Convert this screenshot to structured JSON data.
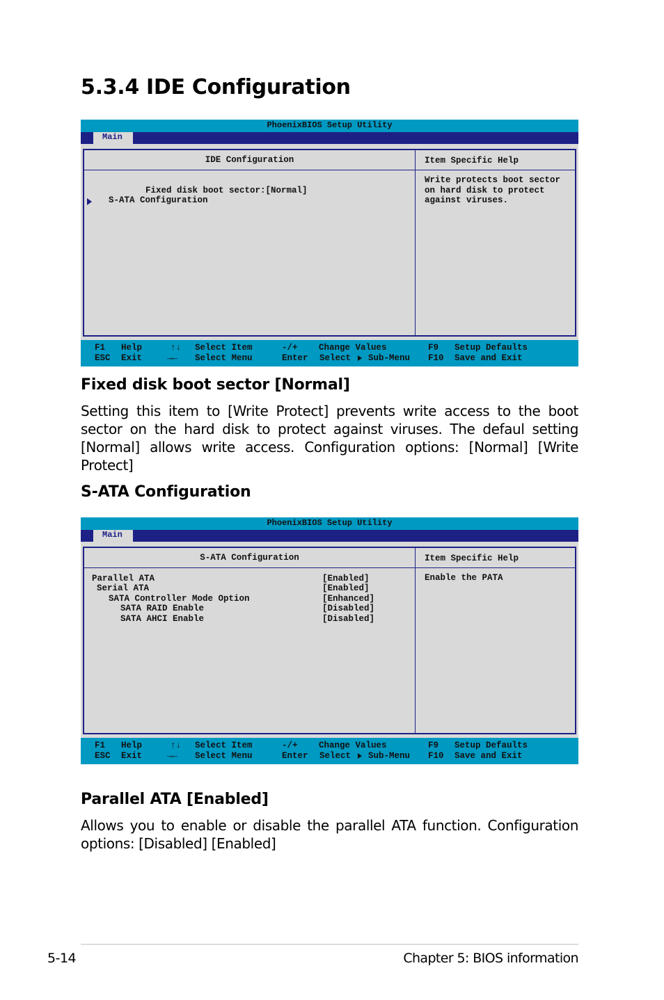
{
  "page_title": "5.3.4 IDE Configuration",
  "screens": [
    {
      "utility_title": "PhoenixBIOS Setup Utility",
      "menu_tab": "Main",
      "panel_title": "IDE Configuration",
      "help_title": "Item Specific Help",
      "help_text": "Write protects boot sector\non hard disk to protect\nagainst viruses.",
      "items": [
        {
          "label": "Fixed disk boot sector:",
          "value": "[Normal]"
        },
        {
          "label": "S-ATA Configuration",
          "submenu": true
        }
      ],
      "footer": {
        "f1": "F1",
        "help": "Help",
        "updown": "↑↓",
        "select_item": "Select Item",
        "minusplus": "-/+",
        "change_values": "Change Values",
        "f9": "F9",
        "setup_defaults": "Setup Defaults",
        "esc": "ESC",
        "exit": "Exit",
        "leftright": "→←",
        "select_menu": "Select Menu",
        "enter": "Enter",
        "select": "Select",
        "sub_menu": "Sub-Menu",
        "f10": "F10",
        "save_exit": "Save and Exit"
      }
    },
    {
      "utility_title": "PhoenixBIOS Setup Utility",
      "menu_tab": "Main",
      "panel_title": "S-ATA Configuration",
      "help_title": "Item Specific Help",
      "help_text": "Enable the PATA",
      "items": [
        {
          "label": "Parallel ATA",
          "value": "[Enabled]"
        },
        {
          "label": "Serial ATA",
          "value": "[Enabled]"
        },
        {
          "label": "SATA Controller Mode Option",
          "value": "[Enhanced]"
        },
        {
          "label": "SATA RAID Enable",
          "value": "[Disabled]"
        },
        {
          "label": "SATA AHCI Enable",
          "value": "[Disabled]"
        }
      ],
      "footer": {
        "f1": "F1",
        "help": "Help",
        "updown": "↑↓",
        "select_item": "Select Item",
        "minusplus": "-/+",
        "change_values": "Change Values",
        "f9": "F9",
        "setup_defaults": "Setup Defaults",
        "esc": "ESC",
        "exit": "Exit",
        "leftright": "→←",
        "select_menu": "Select Menu",
        "enter": "Enter",
        "select": "Select",
        "sub_menu": "Sub-Menu",
        "f10": "F10",
        "save_exit": "Save and Exit"
      }
    }
  ],
  "sections": [
    {
      "heading": "Fixed disk boot sector [Normal]",
      "body": "Setting this item to [Write Protect] prevents write access to the boot sector on the hard disk to protect against viruses. The defaul setting [Normal] allows write access. Configuration options: [Normal] [Write Protect]"
    },
    {
      "heading": "S-ATA Configuration"
    },
    {
      "heading": "Parallel ATA [Enabled]",
      "body": "Allows you to enable or disable the parallel ATA function. Configuration options: [Disabled] [Enabled]"
    }
  ],
  "footer": {
    "page_number": "5-14",
    "chapter": "Chapter 5: BIOS information"
  }
}
